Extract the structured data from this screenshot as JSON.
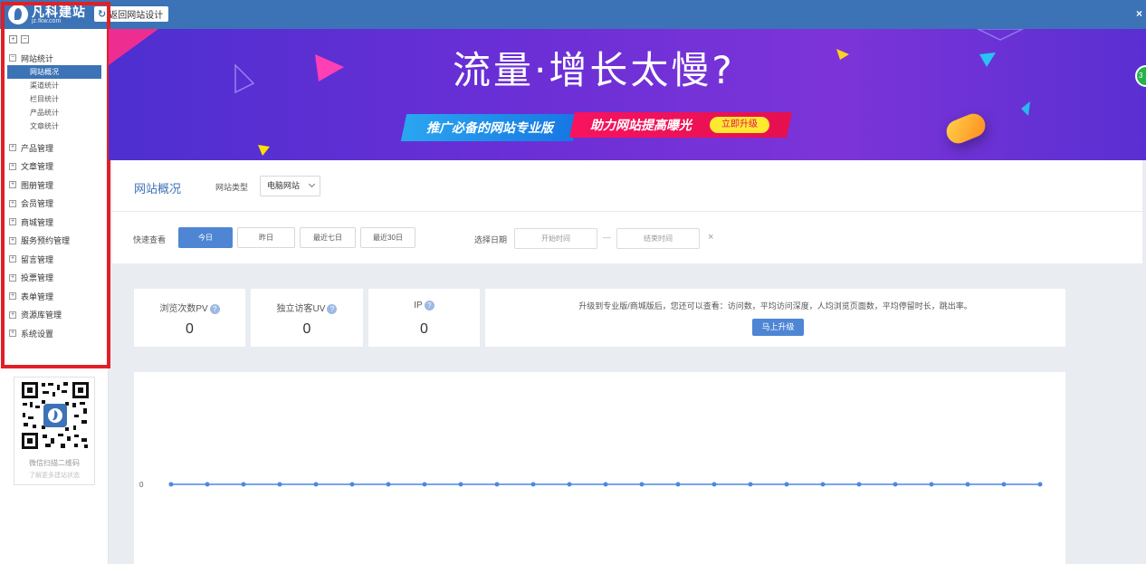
{
  "topbar": {
    "logo_name": "凡科建站",
    "logo_url": "jz.fkw.com",
    "back_label": "返回网站设计",
    "close": "×"
  },
  "sidebar": {
    "tools": [
      "+",
      "−"
    ],
    "groups": [
      {
        "label": "网站统计",
        "expanded": true,
        "children": [
          "网站概况",
          "渠道统计",
          "栏目统计",
          "产品统计",
          "文章统计"
        ],
        "active_child": 0
      },
      {
        "label": "产品管理"
      },
      {
        "label": "文章管理"
      },
      {
        "label": "图册管理"
      },
      {
        "label": "会员管理"
      },
      {
        "label": "商城管理"
      },
      {
        "label": "服务预约管理"
      },
      {
        "label": "留言管理"
      },
      {
        "label": "投票管理"
      },
      {
        "label": "表单管理"
      },
      {
        "label": "资源库管理"
      },
      {
        "label": "系统设置"
      }
    ],
    "qr_text": "微信扫描二维码",
    "qr_subtext": "了解更多建站状态"
  },
  "banner": {
    "title": "流量·增长太慢?",
    "tag_blue": "推广必备的网站专业版",
    "tag_red": "助力网站提高曝光",
    "upgrade": "立即升级",
    "float_badge": "3"
  },
  "overview": {
    "title": "网站概况",
    "site_type_label": "网站类型",
    "site_type_value": "电脑网站"
  },
  "filter": {
    "quick_label": "快速查看",
    "buttons": [
      "今日",
      "昨日",
      "最近七日",
      "最近30日"
    ],
    "active": 0,
    "date_label": "选择日期",
    "start_placeholder": "开始时间",
    "dash": "—",
    "end_placeholder": "结束时间",
    "clear": "×"
  },
  "stats": {
    "pv_label": "浏览次数PV",
    "pv_value": "0",
    "uv_label": "独立访客UV",
    "uv_value": "0",
    "ip_label": "IP",
    "ip_value": "0",
    "help": "?"
  },
  "upgrade": {
    "text": "升级到专业版/商城版后，您还可以查看：访问数，平均访问深度，人均浏览页面数，平均停留时长，跳出率。",
    "button": "马上升级"
  },
  "chart_data": {
    "type": "line",
    "title": "",
    "xlabel": "",
    "ylabel": "",
    "y_tick_labels": [
      "0"
    ],
    "series": [
      {
        "values": [
          0,
          0,
          0,
          0,
          0,
          0,
          0,
          0,
          0,
          0,
          0,
          0,
          0,
          0,
          0,
          0,
          0,
          0,
          0,
          0,
          0,
          0,
          0,
          0,
          0
        ]
      }
    ],
    "color": "#4e86e4"
  }
}
